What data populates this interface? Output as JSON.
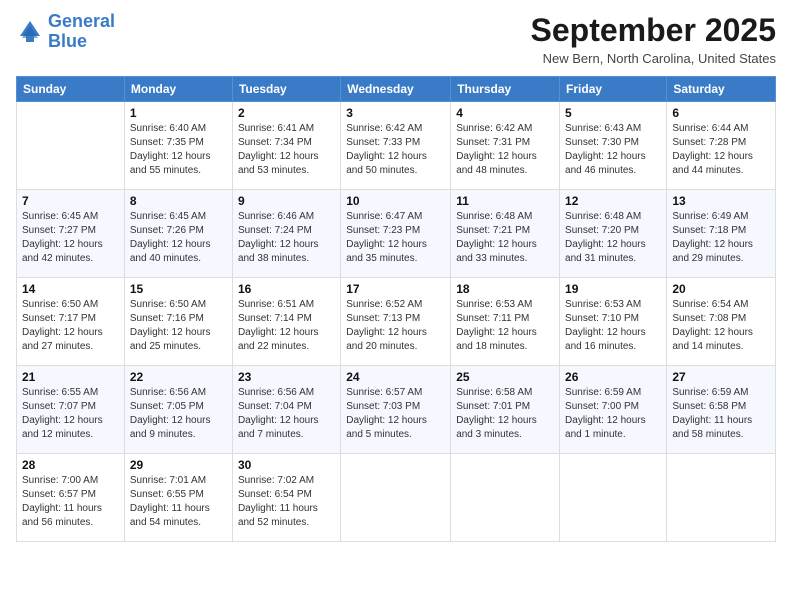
{
  "logo": {
    "line1": "General",
    "line2": "Blue"
  },
  "title": "September 2025",
  "location": "New Bern, North Carolina, United States",
  "days_of_week": [
    "Sunday",
    "Monday",
    "Tuesday",
    "Wednesday",
    "Thursday",
    "Friday",
    "Saturday"
  ],
  "weeks": [
    [
      {
        "day": "",
        "info": ""
      },
      {
        "day": "1",
        "info": "Sunrise: 6:40 AM\nSunset: 7:35 PM\nDaylight: 12 hours\nand 55 minutes."
      },
      {
        "day": "2",
        "info": "Sunrise: 6:41 AM\nSunset: 7:34 PM\nDaylight: 12 hours\nand 53 minutes."
      },
      {
        "day": "3",
        "info": "Sunrise: 6:42 AM\nSunset: 7:33 PM\nDaylight: 12 hours\nand 50 minutes."
      },
      {
        "day": "4",
        "info": "Sunrise: 6:42 AM\nSunset: 7:31 PM\nDaylight: 12 hours\nand 48 minutes."
      },
      {
        "day": "5",
        "info": "Sunrise: 6:43 AM\nSunset: 7:30 PM\nDaylight: 12 hours\nand 46 minutes."
      },
      {
        "day": "6",
        "info": "Sunrise: 6:44 AM\nSunset: 7:28 PM\nDaylight: 12 hours\nand 44 minutes."
      }
    ],
    [
      {
        "day": "7",
        "info": "Sunrise: 6:45 AM\nSunset: 7:27 PM\nDaylight: 12 hours\nand 42 minutes."
      },
      {
        "day": "8",
        "info": "Sunrise: 6:45 AM\nSunset: 7:26 PM\nDaylight: 12 hours\nand 40 minutes."
      },
      {
        "day": "9",
        "info": "Sunrise: 6:46 AM\nSunset: 7:24 PM\nDaylight: 12 hours\nand 38 minutes."
      },
      {
        "day": "10",
        "info": "Sunrise: 6:47 AM\nSunset: 7:23 PM\nDaylight: 12 hours\nand 35 minutes."
      },
      {
        "day": "11",
        "info": "Sunrise: 6:48 AM\nSunset: 7:21 PM\nDaylight: 12 hours\nand 33 minutes."
      },
      {
        "day": "12",
        "info": "Sunrise: 6:48 AM\nSunset: 7:20 PM\nDaylight: 12 hours\nand 31 minutes."
      },
      {
        "day": "13",
        "info": "Sunrise: 6:49 AM\nSunset: 7:18 PM\nDaylight: 12 hours\nand 29 minutes."
      }
    ],
    [
      {
        "day": "14",
        "info": "Sunrise: 6:50 AM\nSunset: 7:17 PM\nDaylight: 12 hours\nand 27 minutes."
      },
      {
        "day": "15",
        "info": "Sunrise: 6:50 AM\nSunset: 7:16 PM\nDaylight: 12 hours\nand 25 minutes."
      },
      {
        "day": "16",
        "info": "Sunrise: 6:51 AM\nSunset: 7:14 PM\nDaylight: 12 hours\nand 22 minutes."
      },
      {
        "day": "17",
        "info": "Sunrise: 6:52 AM\nSunset: 7:13 PM\nDaylight: 12 hours\nand 20 minutes."
      },
      {
        "day": "18",
        "info": "Sunrise: 6:53 AM\nSunset: 7:11 PM\nDaylight: 12 hours\nand 18 minutes."
      },
      {
        "day": "19",
        "info": "Sunrise: 6:53 AM\nSunset: 7:10 PM\nDaylight: 12 hours\nand 16 minutes."
      },
      {
        "day": "20",
        "info": "Sunrise: 6:54 AM\nSunset: 7:08 PM\nDaylight: 12 hours\nand 14 minutes."
      }
    ],
    [
      {
        "day": "21",
        "info": "Sunrise: 6:55 AM\nSunset: 7:07 PM\nDaylight: 12 hours\nand 12 minutes."
      },
      {
        "day": "22",
        "info": "Sunrise: 6:56 AM\nSunset: 7:05 PM\nDaylight: 12 hours\nand 9 minutes."
      },
      {
        "day": "23",
        "info": "Sunrise: 6:56 AM\nSunset: 7:04 PM\nDaylight: 12 hours\nand 7 minutes."
      },
      {
        "day": "24",
        "info": "Sunrise: 6:57 AM\nSunset: 7:03 PM\nDaylight: 12 hours\nand 5 minutes."
      },
      {
        "day": "25",
        "info": "Sunrise: 6:58 AM\nSunset: 7:01 PM\nDaylight: 12 hours\nand 3 minutes."
      },
      {
        "day": "26",
        "info": "Sunrise: 6:59 AM\nSunset: 7:00 PM\nDaylight: 12 hours\nand 1 minute."
      },
      {
        "day": "27",
        "info": "Sunrise: 6:59 AM\nSunset: 6:58 PM\nDaylight: 11 hours\nand 58 minutes."
      }
    ],
    [
      {
        "day": "28",
        "info": "Sunrise: 7:00 AM\nSunset: 6:57 PM\nDaylight: 11 hours\nand 56 minutes."
      },
      {
        "day": "29",
        "info": "Sunrise: 7:01 AM\nSunset: 6:55 PM\nDaylight: 11 hours\nand 54 minutes."
      },
      {
        "day": "30",
        "info": "Sunrise: 7:02 AM\nSunset: 6:54 PM\nDaylight: 11 hours\nand 52 minutes."
      },
      {
        "day": "",
        "info": ""
      },
      {
        "day": "",
        "info": ""
      },
      {
        "day": "",
        "info": ""
      },
      {
        "day": "",
        "info": ""
      }
    ]
  ]
}
